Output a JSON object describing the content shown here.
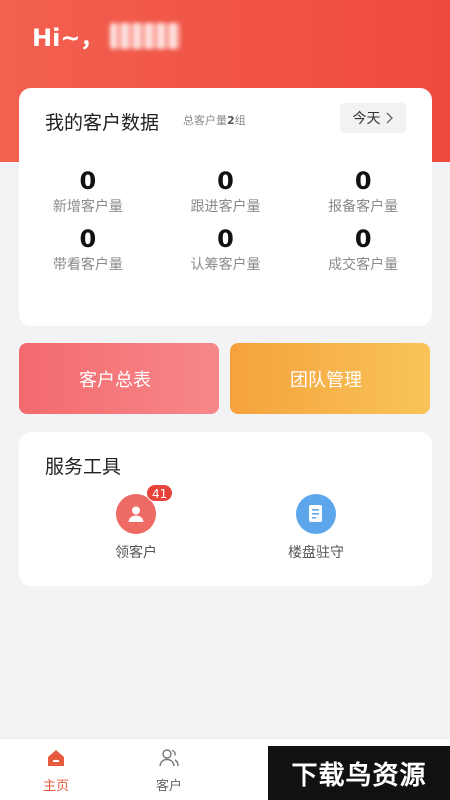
{
  "header": {
    "greeting": "Hi~，"
  },
  "data_card": {
    "title": "我的客户数据",
    "total_prefix": "总客户量",
    "total_value": "2",
    "total_suffix": "组",
    "today_button": "今天",
    "stats": [
      {
        "value": "0",
        "label": "新增客户量"
      },
      {
        "value": "0",
        "label": "跟进客户量"
      },
      {
        "value": "0",
        "label": "报备客户量"
      },
      {
        "value": "0",
        "label": "带看客户量"
      },
      {
        "value": "0",
        "label": "认筹客户量"
      },
      {
        "value": "0",
        "label": "成交客户量"
      }
    ]
  },
  "actions": {
    "customer_table": "客户总表",
    "team_management": "团队管理"
  },
  "tools": {
    "title": "服务工具",
    "items": [
      {
        "label": "领客户",
        "badge": "41",
        "icon": "user-icon"
      },
      {
        "label": "楼盘驻守",
        "icon": "document-icon"
      }
    ]
  },
  "tabbar": {
    "items": [
      {
        "label": "主页",
        "icon": "home-icon",
        "active": true
      },
      {
        "label": "客户",
        "icon": "users-icon",
        "active": false
      }
    ],
    "active_color": "#e85a3e"
  },
  "watermark": "下载鸟资源",
  "colors": {
    "header": "#f04a3e",
    "customer_btn": "#f46a6e",
    "team_btn": "#f6a23c"
  }
}
